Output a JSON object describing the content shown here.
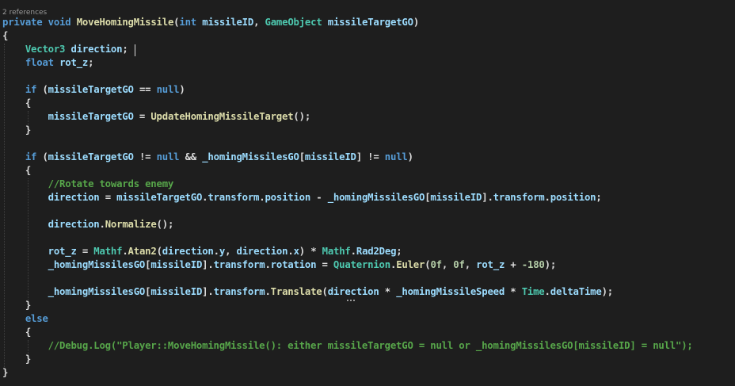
{
  "codelens": "2 references",
  "colors": {
    "background": "#1e1e1e",
    "keyword": "#569cd6",
    "type": "#4ec9b0",
    "method": "#dcdcaa",
    "identifier": "#9cdcfe",
    "punctuation": "#dcdcdc",
    "number": "#b5cea8",
    "comment": "#57a64a"
  },
  "lines": [
    [
      [
        "k",
        "private"
      ],
      [
        "p",
        " "
      ],
      [
        "k",
        "void"
      ],
      [
        "p",
        " "
      ],
      [
        "f",
        "MoveHomingMissile"
      ],
      [
        "p",
        "("
      ],
      [
        "k",
        "int"
      ],
      [
        "p",
        " "
      ],
      [
        "v",
        "missileID"
      ],
      [
        "p",
        ", "
      ],
      [
        "t",
        "GameObject"
      ],
      [
        "p",
        " "
      ],
      [
        "v",
        "missileTargetGO"
      ],
      [
        "p",
        ")"
      ]
    ],
    [
      [
        "p",
        "{"
      ]
    ],
    [
      [
        "p",
        "    "
      ],
      [
        "t",
        "Vector3"
      ],
      [
        "p",
        " "
      ],
      [
        "v",
        "direction"
      ],
      [
        "p",
        ";"
      ]
    ],
    [
      [
        "p",
        "    "
      ],
      [
        "k",
        "float"
      ],
      [
        "p",
        " "
      ],
      [
        "v",
        "rot_z"
      ],
      [
        "p",
        ";"
      ]
    ],
    [],
    [
      [
        "p",
        "    "
      ],
      [
        "k",
        "if"
      ],
      [
        "p",
        " ("
      ],
      [
        "v",
        "missileTargetGO"
      ],
      [
        "p",
        " == "
      ],
      [
        "k",
        "null"
      ],
      [
        "p",
        ")"
      ]
    ],
    [
      [
        "p",
        "    {"
      ]
    ],
    [
      [
        "p",
        "        "
      ],
      [
        "v",
        "missileTargetGO"
      ],
      [
        "p",
        " = "
      ],
      [
        "f",
        "UpdateHomingMissileTarget"
      ],
      [
        "p",
        "();"
      ]
    ],
    [
      [
        "p",
        "    }"
      ]
    ],
    [],
    [
      [
        "p",
        "    "
      ],
      [
        "k",
        "if"
      ],
      [
        "p",
        " ("
      ],
      [
        "v",
        "missileTargetGO"
      ],
      [
        "p",
        " != "
      ],
      [
        "k",
        "null"
      ],
      [
        "p",
        " && "
      ],
      [
        "v",
        "_homingMissilesGO"
      ],
      [
        "p",
        "["
      ],
      [
        "v",
        "missileID"
      ],
      [
        "p",
        "] != "
      ],
      [
        "k",
        "null"
      ],
      [
        "p",
        ")"
      ]
    ],
    [
      [
        "p",
        "    {"
      ]
    ],
    [
      [
        "p",
        "        "
      ],
      [
        "c",
        "//Rotate towards enemy"
      ]
    ],
    [
      [
        "p",
        "        "
      ],
      [
        "v",
        "direction"
      ],
      [
        "p",
        " = "
      ],
      [
        "v",
        "missileTargetGO"
      ],
      [
        "p",
        "."
      ],
      [
        "v",
        "transform"
      ],
      [
        "p",
        "."
      ],
      [
        "v",
        "position"
      ],
      [
        "p",
        " - "
      ],
      [
        "v",
        "_homingMissilesGO"
      ],
      [
        "p",
        "["
      ],
      [
        "v",
        "missileID"
      ],
      [
        "p",
        "]."
      ],
      [
        "v",
        "transform"
      ],
      [
        "p",
        "."
      ],
      [
        "v",
        "position"
      ],
      [
        "p",
        ";"
      ]
    ],
    [],
    [
      [
        "p",
        "        "
      ],
      [
        "v",
        "direction"
      ],
      [
        "p",
        "."
      ],
      [
        "f",
        "Normalize"
      ],
      [
        "p",
        "();"
      ]
    ],
    [],
    [
      [
        "p",
        "        "
      ],
      [
        "v",
        "rot_z"
      ],
      [
        "p",
        " = "
      ],
      [
        "t",
        "Mathf"
      ],
      [
        "p",
        "."
      ],
      [
        "f",
        "Atan2"
      ],
      [
        "p",
        "("
      ],
      [
        "v",
        "direction"
      ],
      [
        "p",
        "."
      ],
      [
        "v",
        "y"
      ],
      [
        "p",
        ", "
      ],
      [
        "v",
        "direction"
      ],
      [
        "p",
        "."
      ],
      [
        "v",
        "x"
      ],
      [
        "p",
        ") * "
      ],
      [
        "t",
        "Mathf"
      ],
      [
        "p",
        "."
      ],
      [
        "v",
        "Rad2Deg"
      ],
      [
        "p",
        ";"
      ]
    ],
    [
      [
        "p",
        "        "
      ],
      [
        "v",
        "_homingMissilesGO"
      ],
      [
        "p",
        "["
      ],
      [
        "v",
        "missileID"
      ],
      [
        "p",
        "]."
      ],
      [
        "v",
        "transform"
      ],
      [
        "p",
        "."
      ],
      [
        "v",
        "rotation"
      ],
      [
        "p",
        " = "
      ],
      [
        "t",
        "Quaternion"
      ],
      [
        "p",
        "."
      ],
      [
        "f",
        "Euler"
      ],
      [
        "p",
        "("
      ],
      [
        "n",
        "0f"
      ],
      [
        "p",
        ", "
      ],
      [
        "n",
        "0f"
      ],
      [
        "p",
        ", "
      ],
      [
        "v",
        "rot_z"
      ],
      [
        "p",
        " + "
      ],
      [
        "n",
        "-180"
      ],
      [
        "p",
        ");"
      ]
    ],
    [],
    [
      [
        "p",
        "        "
      ],
      [
        "v",
        "_homingMissilesGO"
      ],
      [
        "p",
        "["
      ],
      [
        "v",
        "missileID"
      ],
      [
        "p",
        "]."
      ],
      [
        "v",
        "transform"
      ],
      [
        "p",
        "."
      ],
      [
        "f",
        "Translate"
      ],
      [
        "p",
        "("
      ],
      [
        "v",
        "direction"
      ],
      [
        "p",
        " * "
      ],
      [
        "v",
        "_homingMissileSpeed"
      ],
      [
        "p",
        " * "
      ],
      [
        "t",
        "Time"
      ],
      [
        "p",
        "."
      ],
      [
        "v",
        "deltaTime"
      ],
      [
        "p",
        ");"
      ]
    ],
    [
      [
        "p",
        "    }"
      ]
    ],
    [
      [
        "p",
        "    "
      ],
      [
        "k",
        "else"
      ]
    ],
    [
      [
        "p",
        "    {"
      ]
    ],
    [
      [
        "p",
        "        "
      ],
      [
        "c",
        "//Debug.Log(\"Player::MoveHomingMissile(): either missileTargetGO = null or _homingMissilesGO[missileID] = null\");"
      ]
    ],
    [
      [
        "p",
        "    }"
      ]
    ],
    [
      [
        "p",
        "}"
      ]
    ]
  ]
}
